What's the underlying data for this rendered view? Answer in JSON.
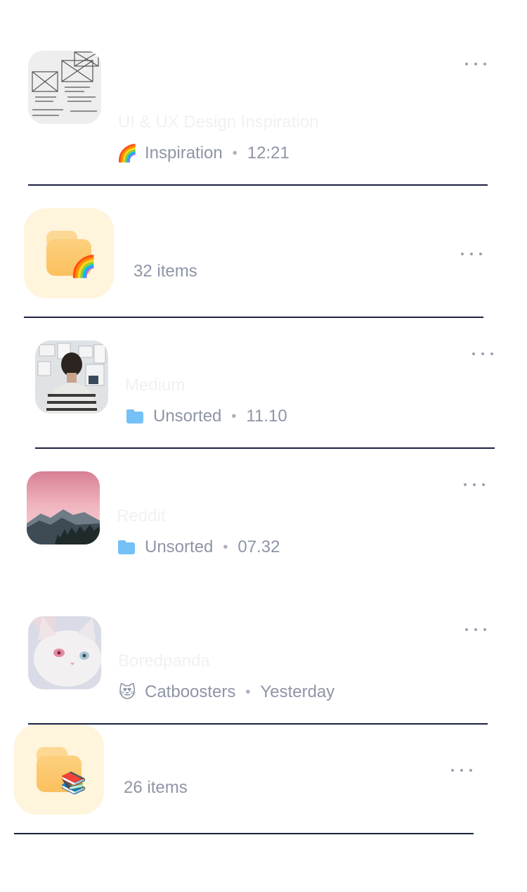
{
  "items": [
    {
      "kind": "link",
      "thumb": "wireframe-sketch-image",
      "title": "UI & UX Design Inspiration",
      "collection_emoji": "🌈",
      "collection": "Inspiration",
      "time": "12:21"
    },
    {
      "kind": "folder",
      "badge_emoji": "🌈",
      "count": "32 items"
    },
    {
      "kind": "link",
      "thumb": "person-at-wall-photo",
      "title": "Medium",
      "collection_icon": "folder-icon",
      "collection": "Unsorted",
      "time": "11.10"
    },
    {
      "kind": "link",
      "thumb": "pink-mountains-photo",
      "title": "Reddit",
      "collection_icon": "folder-icon",
      "collection": "Unsorted",
      "time": "07.32"
    },
    {
      "kind": "link",
      "thumb": "white-cat-photo",
      "title": "Boredpanda",
      "collection_emoji": "😻",
      "collection": "Catboosters",
      "time": "Yesterday"
    },
    {
      "kind": "folder",
      "badge_emoji": "📚",
      "count": "26 items"
    }
  ],
  "colors": {
    "divider": "#1b2140",
    "meta_text": "#8e95a6",
    "folder_bg": "#fff4dc",
    "folder_yellow": "#fbc05e",
    "folder_blue": "#74c0f7"
  }
}
